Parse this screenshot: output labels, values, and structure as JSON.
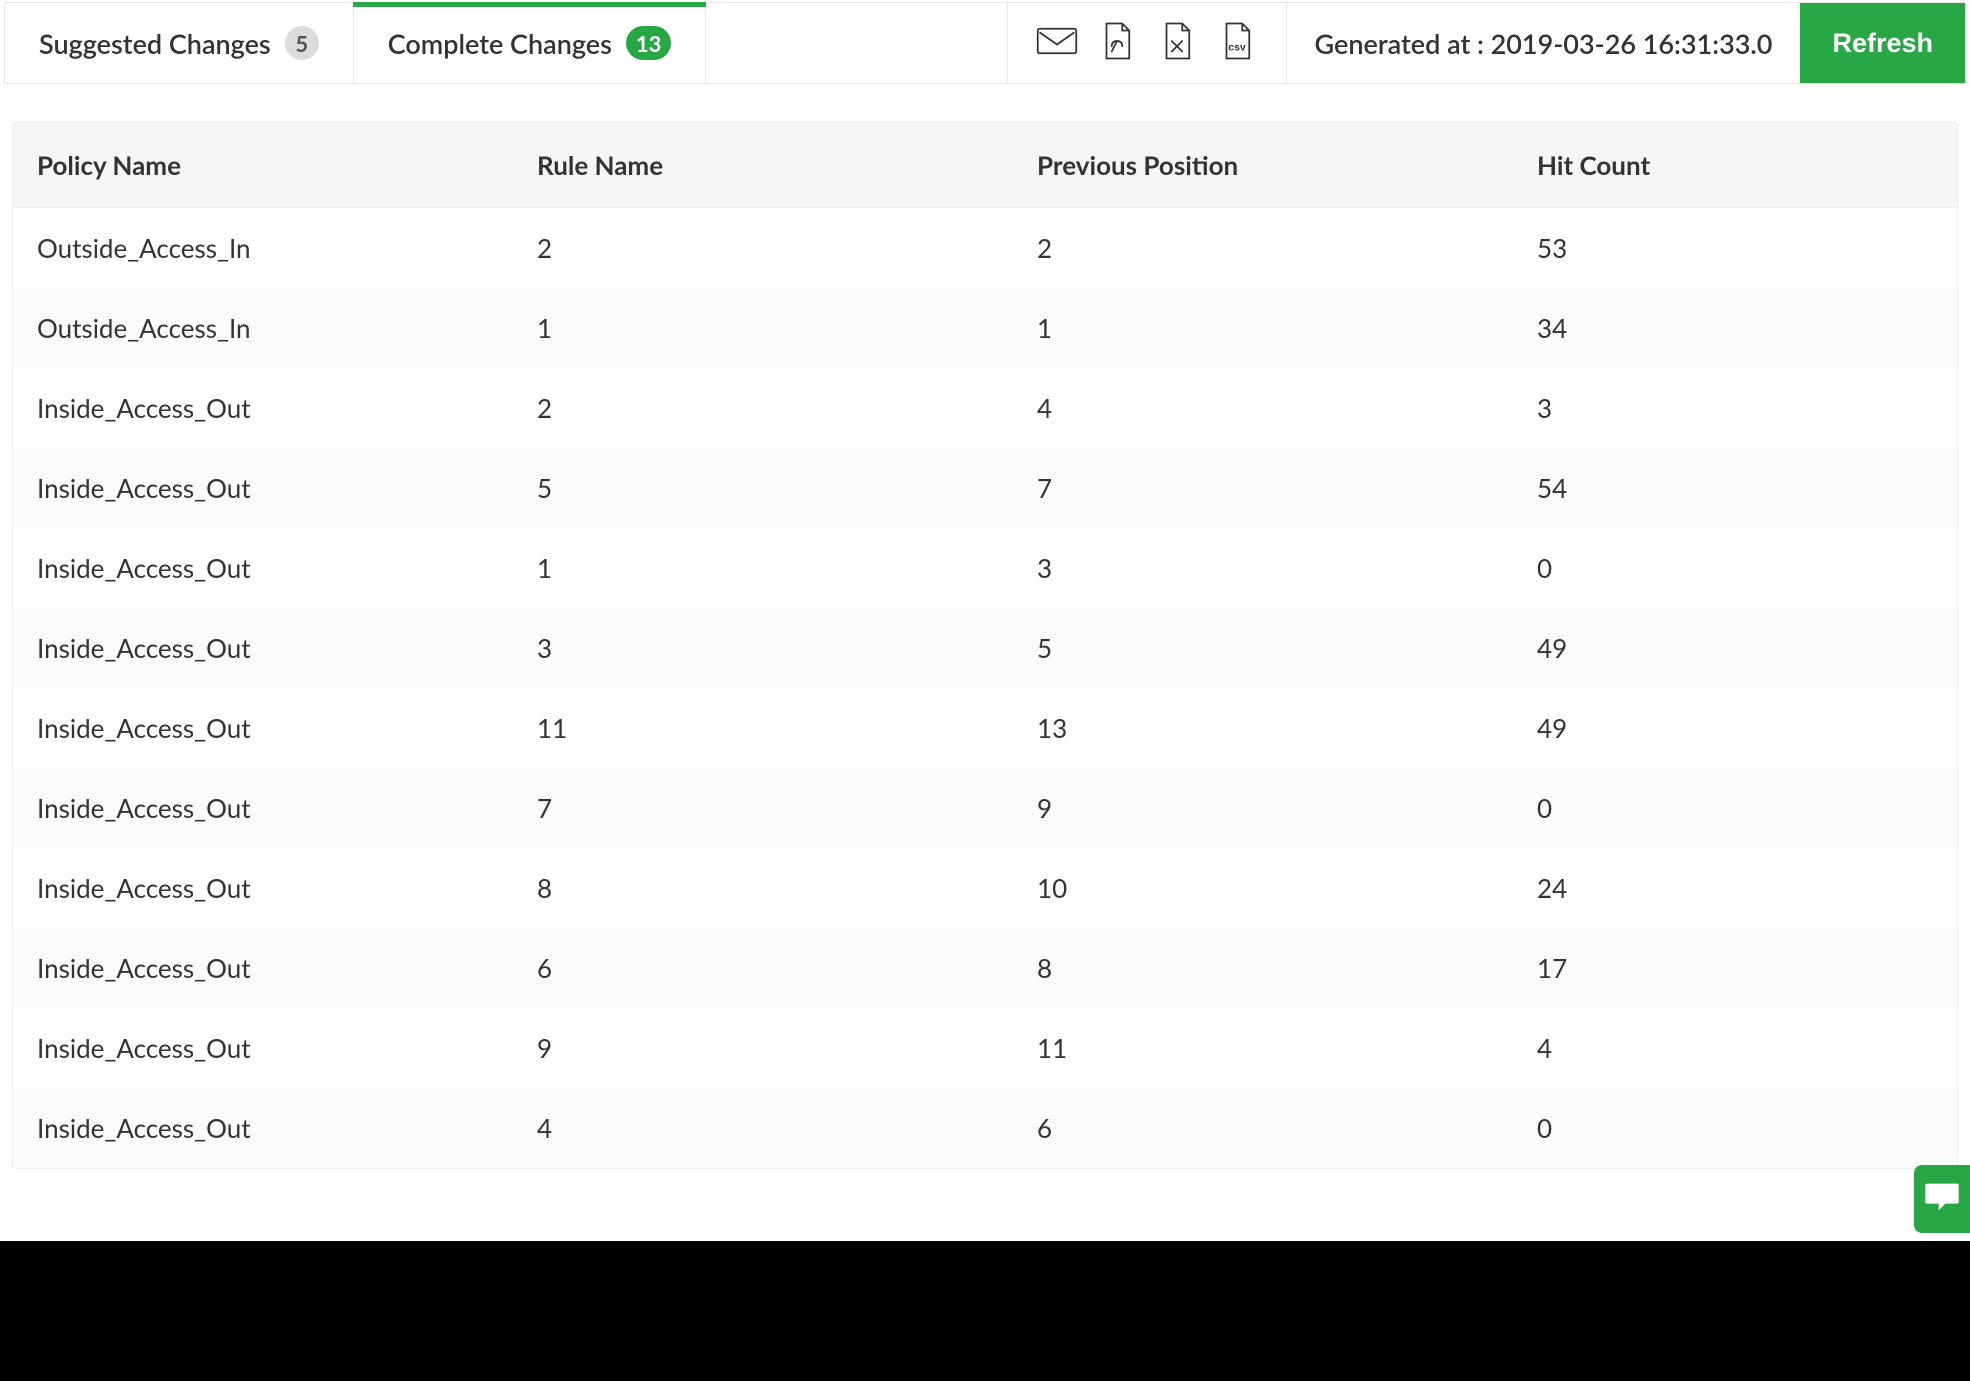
{
  "tabs": {
    "suggested": {
      "label": "Suggested Changes",
      "count": "5"
    },
    "complete": {
      "label": "Complete Changes",
      "count": "13"
    }
  },
  "export": {
    "mail": "mail-icon",
    "pdf": "pdf-icon",
    "xls": "xls-icon",
    "csv": "csv-icon"
  },
  "generated_label": "Generated at : 2019-03-26 16:31:33.0",
  "refresh_label": "Refresh",
  "table": {
    "headers": {
      "policy": "Policy Name",
      "rule": "Rule Name",
      "prev": "Previous Position",
      "hit": "Hit Count"
    },
    "rows": [
      {
        "policy": "Outside_Access_In",
        "rule": "2",
        "prev": "2",
        "hit": "53"
      },
      {
        "policy": "Outside_Access_In",
        "rule": "1",
        "prev": "1",
        "hit": "34"
      },
      {
        "policy": "Inside_Access_Out",
        "rule": "2",
        "prev": "4",
        "hit": "3"
      },
      {
        "policy": "Inside_Access_Out",
        "rule": "5",
        "prev": "7",
        "hit": "54"
      },
      {
        "policy": "Inside_Access_Out",
        "rule": "1",
        "prev": "3",
        "hit": "0"
      },
      {
        "policy": "Inside_Access_Out",
        "rule": "3",
        "prev": "5",
        "hit": "49"
      },
      {
        "policy": "Inside_Access_Out",
        "rule": "11",
        "prev": "13",
        "hit": "49"
      },
      {
        "policy": "Inside_Access_Out",
        "rule": "7",
        "prev": "9",
        "hit": "0"
      },
      {
        "policy": "Inside_Access_Out",
        "rule": "8",
        "prev": "10",
        "hit": "24"
      },
      {
        "policy": "Inside_Access_Out",
        "rule": "6",
        "prev": "8",
        "hit": "17"
      },
      {
        "policy": "Inside_Access_Out",
        "rule": "9",
        "prev": "11",
        "hit": "4"
      },
      {
        "policy": "Inside_Access_Out",
        "rule": "4",
        "prev": "6",
        "hit": "0"
      }
    ]
  }
}
